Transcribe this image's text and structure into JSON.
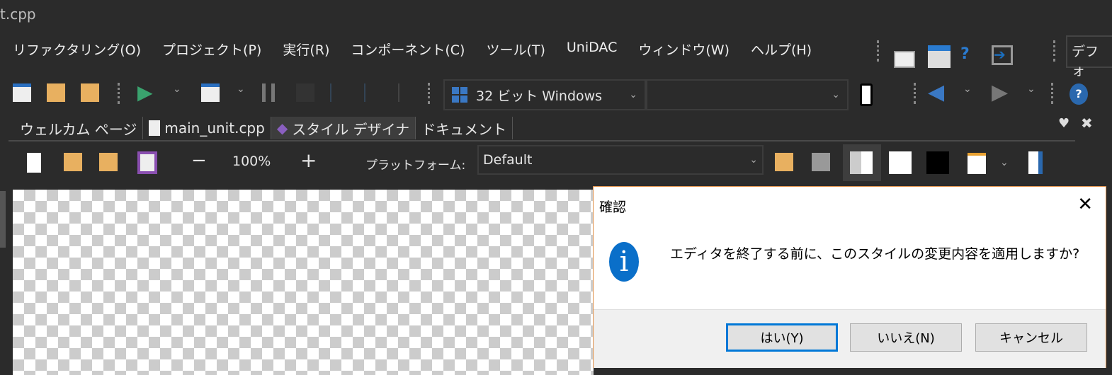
{
  "window": {
    "title": "t.cpp"
  },
  "menu": [
    "リファクタリング(O)",
    "プロジェクト(P)",
    "実行(R)",
    "コンポーネント(C)",
    "ツール(T)",
    "UniDAC",
    "ウィンドウ(W)",
    "ヘルプ(H)"
  ],
  "layout_combo": "デフォ",
  "toolbar": {
    "platform": "32 ビット Windows",
    "config": ""
  },
  "tabs": [
    {
      "label": "ウェルカム ページ"
    },
    {
      "label": "main_unit.cpp"
    },
    {
      "label": "スタイル デザイナ"
    },
    {
      "label": "ドキュメント"
    }
  ],
  "designer": {
    "zoom": "100%",
    "platform_label": "プラットフォーム:",
    "platform_value": "Default",
    "minus": "−",
    "plus": "+"
  },
  "dialog": {
    "title": "確認",
    "close": "✕",
    "message": "エディタを終了する前に、このスタイルの変更内容を適用しますか?",
    "buttons": {
      "yes": "はい(Y)",
      "no": "いいえ(N)",
      "cancel": "キャンセル"
    }
  }
}
